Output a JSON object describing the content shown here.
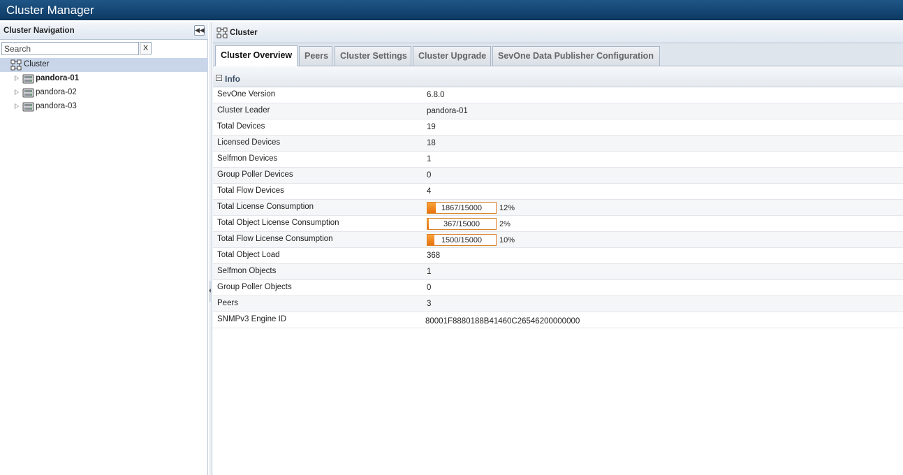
{
  "app": {
    "title": "Cluster Manager"
  },
  "nav": {
    "header": "Cluster Navigation",
    "collapse_icon": "double-chevron-left-icon",
    "search": {
      "placeholder": "Search",
      "value": "",
      "clear_label": "X"
    },
    "root": {
      "label": "Cluster",
      "icon": "cluster-icon"
    },
    "nodes": [
      {
        "label": "pandora-01",
        "bold": true,
        "icon": "server-icon"
      },
      {
        "label": "pandora-02",
        "bold": false,
        "icon": "server-icon"
      },
      {
        "label": "pandora-03",
        "bold": false,
        "icon": "server-icon"
      }
    ]
  },
  "main": {
    "header": "Cluster",
    "tabs": [
      {
        "label": "Cluster Overview",
        "active": true
      },
      {
        "label": "Peers",
        "active": false
      },
      {
        "label": "Cluster Settings",
        "active": false
      },
      {
        "label": "Cluster Upgrade",
        "active": false
      },
      {
        "label": "SevOne Data Publisher Configuration",
        "active": false
      }
    ],
    "section": {
      "title": "Info"
    },
    "rows": [
      {
        "key": "SevOne Version",
        "value": "6.8.0"
      },
      {
        "key": "Cluster Leader",
        "value": "pandora-01"
      },
      {
        "key": "Total Devices",
        "value": "19"
      },
      {
        "key": "Licensed Devices",
        "value": "18"
      },
      {
        "key": "Selfmon Devices",
        "value": "1"
      },
      {
        "key": "Group Poller Devices",
        "value": "0"
      },
      {
        "key": "Total Flow Devices",
        "value": "4"
      },
      {
        "key": "Total License Consumption",
        "progress_text": "1867/15000",
        "fraction": 0.12,
        "percent": "12%"
      },
      {
        "key": "Total Object License Consumption",
        "progress_text": "367/15000",
        "fraction": 0.02,
        "percent": "2%"
      },
      {
        "key": "Total Flow License Consumption",
        "progress_text": "1500/15000",
        "fraction": 0.1,
        "percent": "10%"
      },
      {
        "key": "Total Object Load",
        "value": "368"
      },
      {
        "key": "Selfmon Objects",
        "value": "1"
      },
      {
        "key": "Group Poller Objects",
        "value": "0"
      },
      {
        "key": "Peers",
        "value": "3"
      },
      {
        "key": "SNMPv3 Engine ID",
        "value": "80001F8880188B41460C26546200000000"
      }
    ]
  },
  "colors": {
    "titlebar": "#0d3a64",
    "selected": "#c9d6ea",
    "progress_fill": "#f08a1d",
    "progress_border": "#d9822b"
  }
}
